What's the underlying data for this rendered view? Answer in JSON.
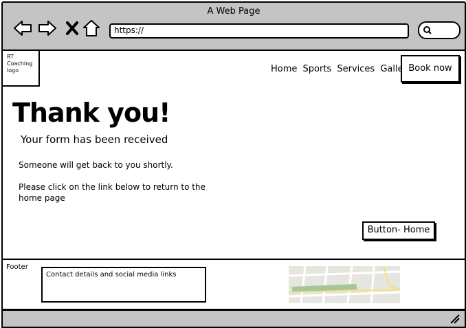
{
  "window": {
    "title": "A Web Page"
  },
  "browser": {
    "url": "https://"
  },
  "header": {
    "logo": "RT Coaching logo",
    "nav": [
      "Home",
      "Sports",
      "Services",
      "Gallery"
    ],
    "cta": "Book now"
  },
  "main": {
    "heading": "Thank you!",
    "subheading": "Your form has been received",
    "message": "Someone will get back to you shortly.",
    "instruction": "Please click on the link below to return to the home page",
    "home_button": "Button- Home"
  },
  "footer": {
    "label": "Footer",
    "contact": "Contact details and social media links"
  },
  "colors": {
    "chrome": "#c4c4c4",
    "map_green": "#a7c59a",
    "map_road": "#f2e27a"
  }
}
